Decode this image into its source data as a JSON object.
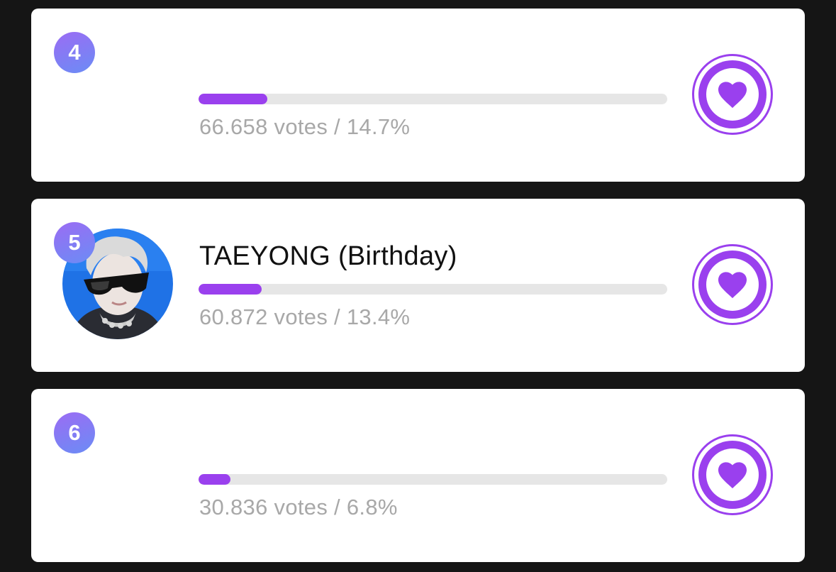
{
  "colors": {
    "accent": "#9a40ee",
    "track": "#e6e6e6",
    "muted_text": "#a8a8a8",
    "background": "#151515"
  },
  "entries": [
    {
      "rank": "4",
      "name": "",
      "stats": "66.658 votes / 14.7%",
      "percent": 14.7,
      "has_avatar": false,
      "vote_icon": "heart-icon"
    },
    {
      "rank": "5",
      "name": "TAEYONG (Birthday)",
      "stats": "60.872 votes / 13.4%",
      "percent": 13.4,
      "has_avatar": true,
      "vote_icon": "heart-icon"
    },
    {
      "rank": "6",
      "name": "",
      "stats": "30.836 votes / 6.8%",
      "percent": 6.8,
      "has_avatar": false,
      "vote_icon": "heart-icon"
    }
  ]
}
